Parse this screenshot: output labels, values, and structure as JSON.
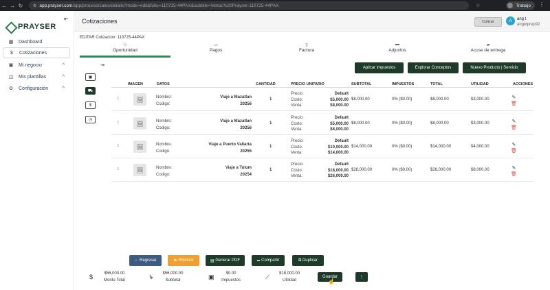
{
  "browser": {
    "url_host": "app.prayser.com",
    "url_path": "/app/process/sales/details?mode=edit&folio=110725-44PAX&subtitle=Venta:%20Prayser-110725-44PAX",
    "profile": "Trabajo"
  },
  "sidebar": {
    "logo": "PRAYSER",
    "items": [
      {
        "label": "Dashboard",
        "icon": "grid-icon"
      },
      {
        "label": "Cotizaciones",
        "icon": "dollar-circle-icon"
      },
      {
        "label": "Mi negocio",
        "icon": "briefcase-icon"
      },
      {
        "label": "Mis plantillas",
        "icon": "layers-icon"
      },
      {
        "label": "Configuración",
        "icon": "gear-icon"
      }
    ]
  },
  "header": {
    "title": "Cotizaciones",
    "cotizar": "Cotizar",
    "user_name": "ang t",
    "user_email": "angelprep92",
    "avatar": "A"
  },
  "edit_label": "EDITAR Cotizacion: 110725-44PAX",
  "tabs": [
    {
      "label": "Oportunidad",
      "icon": "users-icon"
    },
    {
      "label": "Pagos",
      "icon": "card-icon"
    },
    {
      "label": "Factura",
      "icon": "file-icon"
    },
    {
      "label": "Adjuntos",
      "icon": "folder-icon"
    },
    {
      "label": "Acuse de entrega",
      "icon": "truck-icon"
    }
  ],
  "actions": {
    "apply_taxes": "Aplicar impuestos",
    "explore": "Explorar Conceptos",
    "new_product": "Nuevo Producto | Servicio"
  },
  "table": {
    "headers": {
      "imagen": "IMAGEN",
      "datos": "DATOS",
      "cantidad": "CANTIDAD",
      "precio": "PRECIO UNITARIO",
      "subtotal": "SUBTOTAL",
      "impuestos": "IMPUESTOS",
      "total": "TOTAL",
      "utilidad": "UTILIDAD",
      "acciones": "ACCIONES"
    },
    "labels": {
      "nombre": "Nombre:",
      "codigo": "Codigo:",
      "precio": "Precio:",
      "costo": "Costo:",
      "venta": "Venta:"
    },
    "rows": [
      {
        "name": "Viaje a Mazatlan",
        "code": "20256",
        "qty": "1",
        "precio": "Default",
        "costo": "$5,000.00",
        "venta": "$8,000.00",
        "subtotal": "$8,000.00",
        "impuestos": "0% ($0.00)",
        "total": "$8,000.00",
        "utilidad": "$3,000.00"
      },
      {
        "name": "Viaje a Mazatlan",
        "code": "20256",
        "qty": "1",
        "precio": "Default",
        "costo": "$5,000.00",
        "venta": "$8,000.00",
        "subtotal": "$8,000.00",
        "impuestos": "0% ($0.00)",
        "total": "$8,000.00",
        "utilidad": "$3,000.00"
      },
      {
        "name": "Viaje a Puerto Vallarta",
        "code": "20255",
        "qty": "1",
        "precio": "Default",
        "costo": "$10,000.00",
        "venta": "$14,000.00",
        "subtotal": "$14,000.00",
        "impuestos": "0% ($0.00)",
        "total": "$14,000.00",
        "utilidad": "$4,000.00"
      },
      {
        "name": "Viaje a Tulum",
        "code": "20254",
        "qty": "1",
        "precio": "Default",
        "costo": "$18,000.00",
        "venta": "$26,000.00",
        "subtotal": "$26,000.00",
        "impuestos": "0% ($0.00)",
        "total": "$26,000.00",
        "utilidad": "$8,000.00"
      }
    ]
  },
  "footer": {
    "regresar": "Regresar",
    "priorizar": "Priorizar",
    "pdf": "Generar PDF",
    "compartir": "Compartir",
    "duplicar": "Duplicar",
    "monto_total_value": "$56,000.00",
    "monto_total_label": "Monto Total",
    "subtotal_value": "$56,000.00",
    "subtotal_label": "Subtotal",
    "impuestos_value": "$0.00",
    "impuestos_label": "Impuestos",
    "utilidad_value": "$18,000.00",
    "utilidad_label": "Utilidad",
    "guardar": "Guardar",
    "more": "⋮",
    "colors": {
      "regresar": "#3d5a80",
      "priorizar": "#f0a030",
      "dark": "#1e3a2b"
    }
  }
}
